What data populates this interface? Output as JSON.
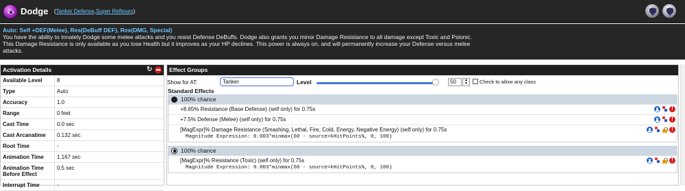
{
  "header": {
    "title": "Dodge",
    "sets_open": "(",
    "sets": [
      "Tanker Defense",
      "Super Reflexes"
    ],
    "sets_sep": ",",
    "sets_close": ")",
    "power_icon": "dodge-power-icon",
    "badges": [
      "archetype-badge-icon",
      "archetype-badge-alt-icon"
    ]
  },
  "description": {
    "short": "Auto: Self +DEF(Melee), Res(DeBuff DEF), Res(DMG, Special)",
    "long": "You have the ability to innately Dodge some melee attacks and you resist Defense DeBuffs. Dodge also grants you minor Damage Resistance to all damage except Toxic and Psionic. This Damage Resistance is only available as you lose Health but it improves as your HP declines. This power is always on, and will permanently increase your Defense versus melee attacks."
  },
  "activation": {
    "title": "Activation Details",
    "rows": [
      {
        "key": "Available Level",
        "value": "8"
      },
      {
        "key": "Type",
        "value": "Auto"
      },
      {
        "key": "Accuracy",
        "value": "1.0"
      },
      {
        "key": "Range",
        "value": "0 feet"
      },
      {
        "key": "Cast Time",
        "value": "0.0 sec"
      },
      {
        "key": "Cast Arcanatime",
        "value": "0.132 sec"
      },
      {
        "key": "Root Time",
        "value": "-"
      },
      {
        "key": "Animation Time",
        "value": "1.167 sec"
      },
      {
        "key": "Animation Time Before Effect",
        "value": "0.5 sec"
      },
      {
        "key": "Interrupt Time",
        "value": "-"
      }
    ]
  },
  "effects": {
    "title": "Effect Groups",
    "show_for_at_label": "Show for AT:",
    "at_value": "Tanker",
    "level_label": "Level",
    "level_value": "50",
    "level_fraction": 0.98,
    "check_label": "Check to allow any class",
    "standard_title": "Standard Effects",
    "groups": [
      {
        "chance": "100% chance",
        "effects": [
          {
            "text": "+8.65% Resistance (Base Defense) (self only) for 0.75s",
            "magnitude": ""
          },
          {
            "text": "+7.5% Defense (Melee) (self only) for 0.75s",
            "magnitude": ""
          },
          {
            "text": "[MagExpr]% Damage Resistance (Smashing, Lethal, Fire, Cold, Energy, Negative Energy) (self only) for 0.75s",
            "magnitude": "Magnitude Expression: 0.003*minmax(60 - source>kHitPoints%, 0, 100)"
          }
        ]
      },
      {
        "chance": "100% chance",
        "effects": [
          {
            "text": "[MagExpr]% Resistance (Toxic) (self only) for 0.75s",
            "magnitude": "Magnitude Expression: 0.003*minmax(60 - source>kHitPoints%, 0, 100)"
          }
        ]
      }
    ]
  }
}
